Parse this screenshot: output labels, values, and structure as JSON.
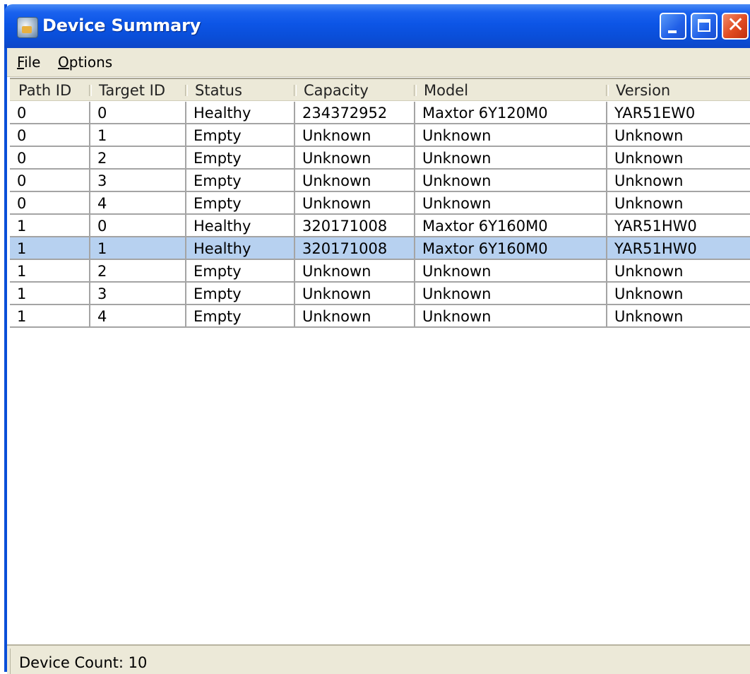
{
  "window": {
    "title": "Device Summary"
  },
  "menu": [
    {
      "label": "File",
      "mnemonic": "F"
    },
    {
      "label": "Options",
      "mnemonic": "O"
    }
  ],
  "table": {
    "columns": [
      "Path ID",
      "Target ID",
      "Status",
      "Capacity",
      "Model",
      "Version"
    ],
    "rows": [
      {
        "path_id": "0",
        "target_id": "0",
        "status": "Healthy",
        "capacity": "234372952",
        "model": "Maxtor 6Y120M0",
        "version": "YAR51EW0",
        "selected": false
      },
      {
        "path_id": "0",
        "target_id": "1",
        "status": "Empty",
        "capacity": "Unknown",
        "model": "Unknown",
        "version": "Unknown",
        "selected": false
      },
      {
        "path_id": "0",
        "target_id": "2",
        "status": "Empty",
        "capacity": "Unknown",
        "model": "Unknown",
        "version": "Unknown",
        "selected": false
      },
      {
        "path_id": "0",
        "target_id": "3",
        "status": "Empty",
        "capacity": "Unknown",
        "model": "Unknown",
        "version": "Unknown",
        "selected": false
      },
      {
        "path_id": "0",
        "target_id": "4",
        "status": "Empty",
        "capacity": "Unknown",
        "model": "Unknown",
        "version": "Unknown",
        "selected": false
      },
      {
        "path_id": "1",
        "target_id": "0",
        "status": "Healthy",
        "capacity": "320171008",
        "model": "Maxtor 6Y160M0",
        "version": "YAR51HW0",
        "selected": false
      },
      {
        "path_id": "1",
        "target_id": "1",
        "status": "Healthy",
        "capacity": "320171008",
        "model": "Maxtor 6Y160M0",
        "version": "YAR51HW0",
        "selected": true
      },
      {
        "path_id": "1",
        "target_id": "2",
        "status": "Empty",
        "capacity": "Unknown",
        "model": "Unknown",
        "version": "Unknown",
        "selected": false
      },
      {
        "path_id": "1",
        "target_id": "3",
        "status": "Empty",
        "capacity": "Unknown",
        "model": "Unknown",
        "version": "Unknown",
        "selected": false
      },
      {
        "path_id": "1",
        "target_id": "4",
        "status": "Empty",
        "capacity": "Unknown",
        "model": "Unknown",
        "version": "Unknown",
        "selected": false
      }
    ]
  },
  "status_bar": {
    "text": "Device Count: 10"
  },
  "colors": {
    "titlebar": "#0a4ed8",
    "selection": "#b7d1f0",
    "chrome": "#ece9d8",
    "grid": "#a4a4a4",
    "close_button": "#e04a20"
  },
  "icons": {
    "app": "device-summary-app-icon",
    "minimize": "minimize-icon",
    "maximize": "maximize-icon",
    "close": "close-icon"
  }
}
